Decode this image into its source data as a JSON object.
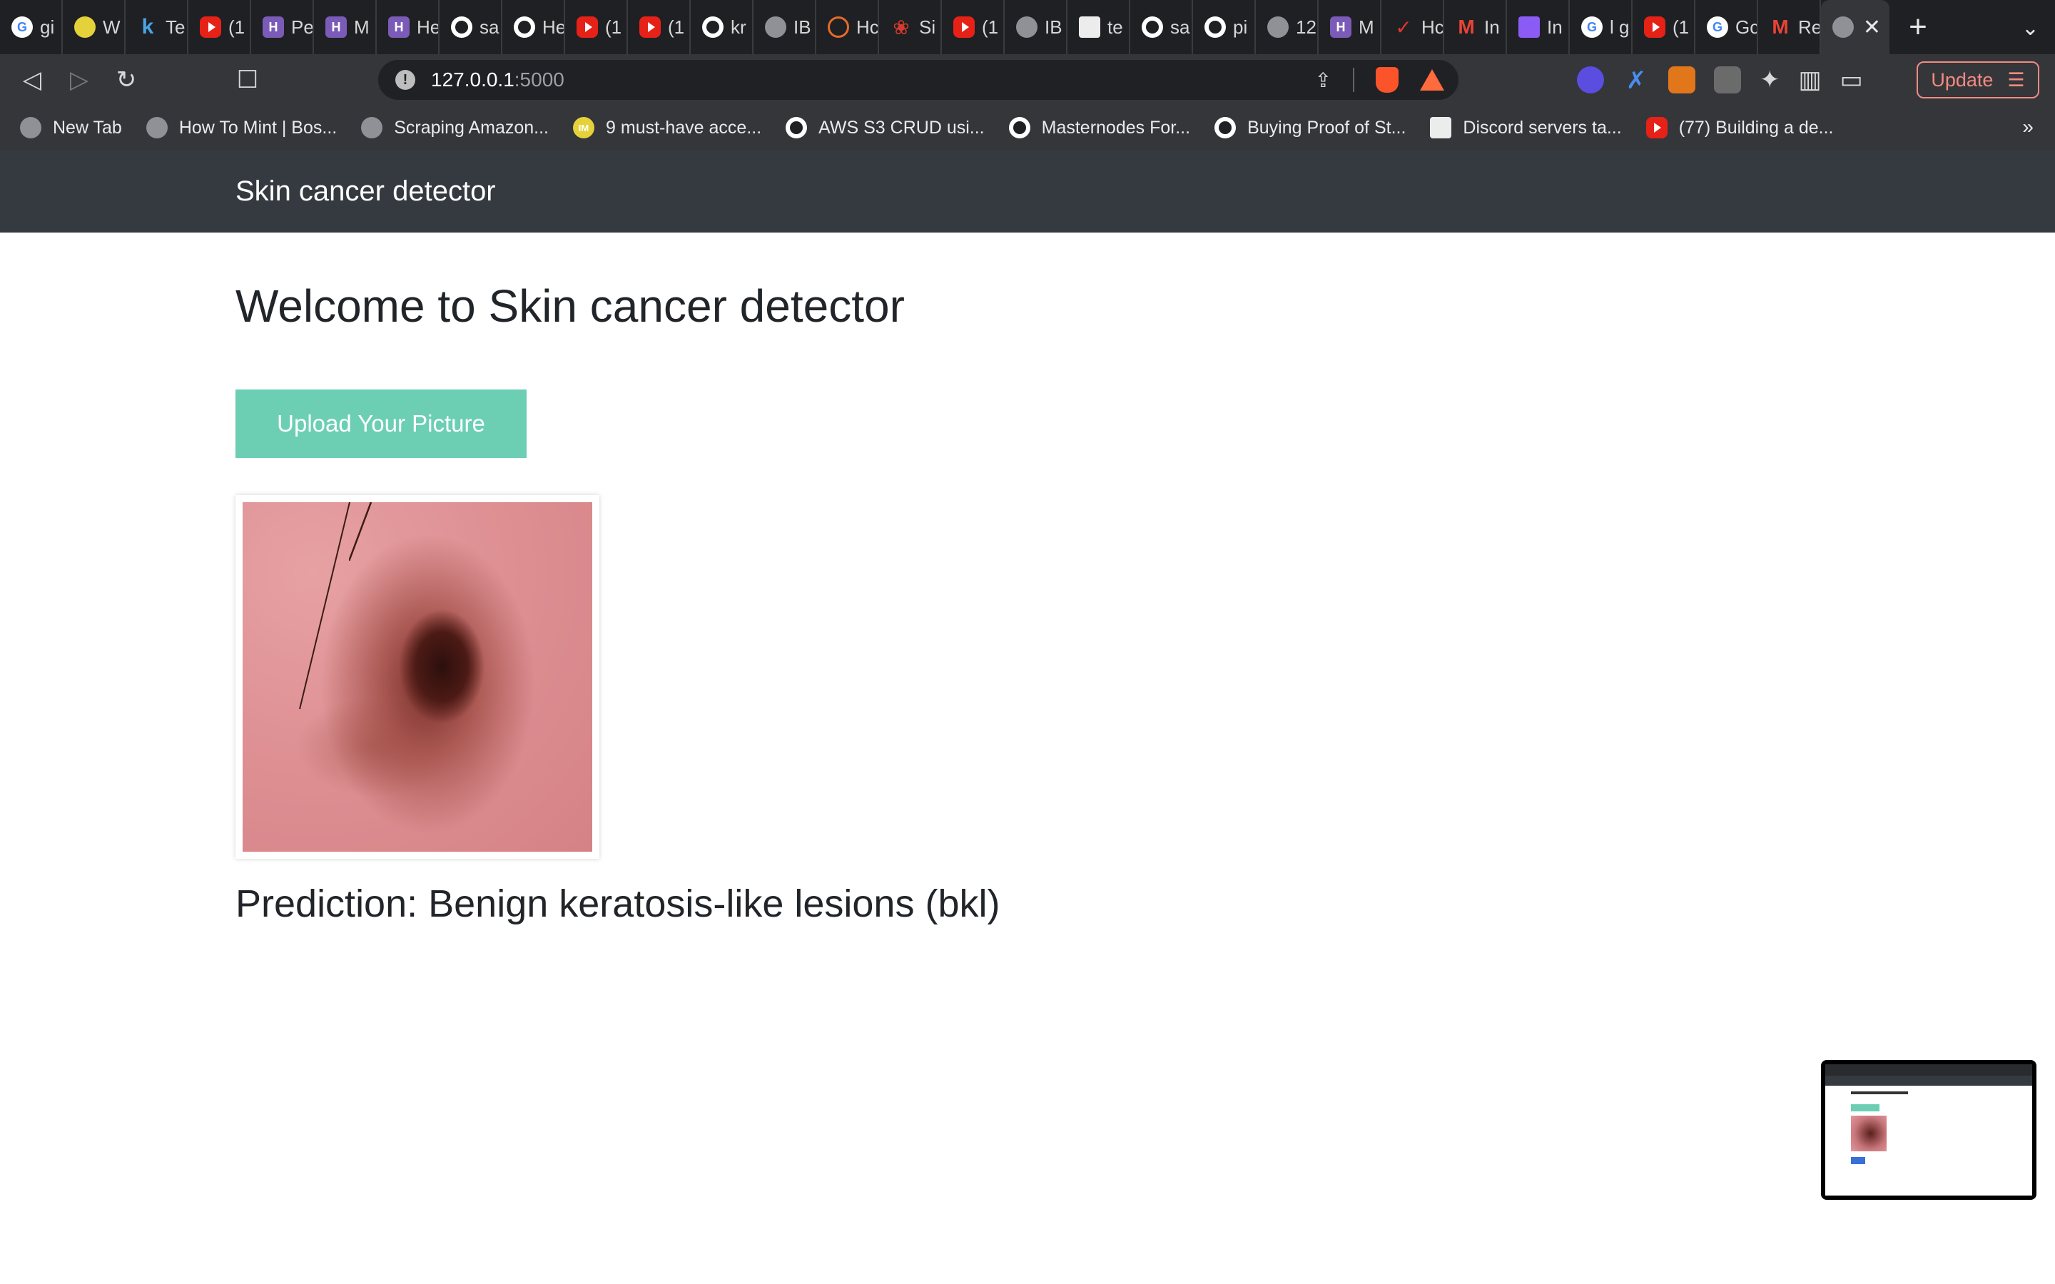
{
  "browser": {
    "tabs": [
      {
        "label": "gi",
        "icon": "google-icon",
        "fav": "g",
        "glyph": "G"
      },
      {
        "label": "W",
        "icon": "lemon-icon",
        "fav": "lemon",
        "glyph": ""
      },
      {
        "label": "Te",
        "icon": "k-icon",
        "fav": "k",
        "glyph": "k"
      },
      {
        "label": "(1",
        "icon": "youtube-icon",
        "fav": "yt",
        "glyph": ""
      },
      {
        "label": "Pe",
        "icon": "hackernoon-icon",
        "fav": "hk",
        "glyph": "H"
      },
      {
        "label": "M",
        "icon": "hackernoon-icon",
        "fav": "hk",
        "glyph": "H"
      },
      {
        "label": "He",
        "icon": "hackernoon-icon",
        "fav": "hk",
        "glyph": "H"
      },
      {
        "label": "sa",
        "icon": "github-icon",
        "fav": "gh",
        "glyph": ""
      },
      {
        "label": "He",
        "icon": "github-icon",
        "fav": "gh",
        "glyph": ""
      },
      {
        "label": "(1",
        "icon": "youtube-icon",
        "fav": "yt",
        "glyph": ""
      },
      {
        "label": "(1",
        "icon": "youtube-icon",
        "fav": "yt",
        "glyph": ""
      },
      {
        "label": "kr",
        "icon": "github-icon",
        "fav": "gh",
        "glyph": ""
      },
      {
        "label": "IB",
        "icon": "globe-icon",
        "fav": "globe",
        "glyph": ""
      },
      {
        "label": "Hc",
        "icon": "swirl-icon",
        "fav": "sw",
        "glyph": ""
      },
      {
        "label": "Si",
        "icon": "maple-leaf-icon",
        "fav": "leaf",
        "glyph": "❀"
      },
      {
        "label": "(1",
        "icon": "youtube-icon",
        "fav": "yt",
        "glyph": ""
      },
      {
        "label": "IB",
        "icon": "globe-icon",
        "fav": "globe",
        "glyph": ""
      },
      {
        "label": "te",
        "icon": "cube-icon",
        "fav": "cube",
        "glyph": ""
      },
      {
        "label": "sa",
        "icon": "github-icon",
        "fav": "gh",
        "glyph": ""
      },
      {
        "label": "pi",
        "icon": "github-icon",
        "fav": "gh",
        "glyph": ""
      },
      {
        "label": "12",
        "icon": "globe-icon",
        "fav": "globe",
        "glyph": ""
      },
      {
        "label": "M",
        "icon": "hackernoon-icon",
        "fav": "hk",
        "glyph": "H"
      },
      {
        "label": "Hc",
        "icon": "checkmark-icon",
        "fav": "check",
        "glyph": "✓"
      },
      {
        "label": "In",
        "icon": "gmail-icon",
        "fav": "gm",
        "glyph": "M"
      },
      {
        "label": "In",
        "icon": "puzzle-icon",
        "fav": "ms",
        "glyph": ""
      },
      {
        "label": "l g",
        "icon": "google-icon",
        "fav": "g",
        "glyph": "G"
      },
      {
        "label": "(1",
        "icon": "youtube-icon",
        "fav": "yt",
        "glyph": ""
      },
      {
        "label": "Gc",
        "icon": "google-icon",
        "fav": "g",
        "glyph": "G"
      },
      {
        "label": "Re",
        "icon": "gmail-icon",
        "fav": "gm",
        "glyph": "M"
      }
    ],
    "active_tab": {
      "label": "",
      "icon": "globe-icon"
    },
    "close_glyph": "✕",
    "new_tab_glyph": "+",
    "tab_list_glyph": "⌄",
    "back_glyph": "◁",
    "forward_glyph": "▷",
    "reload_glyph": "↻",
    "bookmark_glyph": "☐",
    "address": {
      "host": "127.0.0.1",
      "port": ":5000",
      "info_glyph": "!"
    },
    "share_glyph": "⇪",
    "extension_glyph": "✦",
    "sidebar_glyph": "▥",
    "wallet_glyph": "▭",
    "update": {
      "label": "Update",
      "menu_glyph": "☰"
    },
    "bookmarks": [
      {
        "label": "New Tab",
        "icon": "globe-icon",
        "fav": "globe",
        "glyph": ""
      },
      {
        "label": "How To Mint | Bos...",
        "icon": "raccoon-icon",
        "fav": "globe",
        "glyph": ""
      },
      {
        "label": "Scraping Amazon...",
        "icon": "globe-icon",
        "fav": "globe",
        "glyph": ""
      },
      {
        "label": "9 must-have acce...",
        "icon": "im-icon",
        "fav": "lemon",
        "glyph": "IM"
      },
      {
        "label": "AWS S3 CRUD usi...",
        "icon": "medium-icon",
        "fav": "gh",
        "glyph": ""
      },
      {
        "label": "Masternodes For...",
        "icon": "medium-icon",
        "fav": "gh",
        "glyph": ""
      },
      {
        "label": "Buying Proof of St...",
        "icon": "medium-icon",
        "fav": "gh",
        "glyph": ""
      },
      {
        "label": "Discord servers ta...",
        "icon": "discord-icon",
        "fav": "cube",
        "glyph": ""
      },
      {
        "label": "(77) Building a de...",
        "icon": "youtube-icon",
        "fav": "yt",
        "glyph": ""
      }
    ],
    "bookmarks_more_glyph": "»"
  },
  "page": {
    "brand": "Skin cancer detector",
    "title": "Welcome to Skin cancer detector",
    "upload_label": "Upload Your Picture",
    "prediction": "Prediction: Benign keratosis-like lesions (bkl)"
  },
  "colors": {
    "navbar": "#343a40",
    "upload_button": "#6ccfb4",
    "update_accent": "#f28b82"
  }
}
